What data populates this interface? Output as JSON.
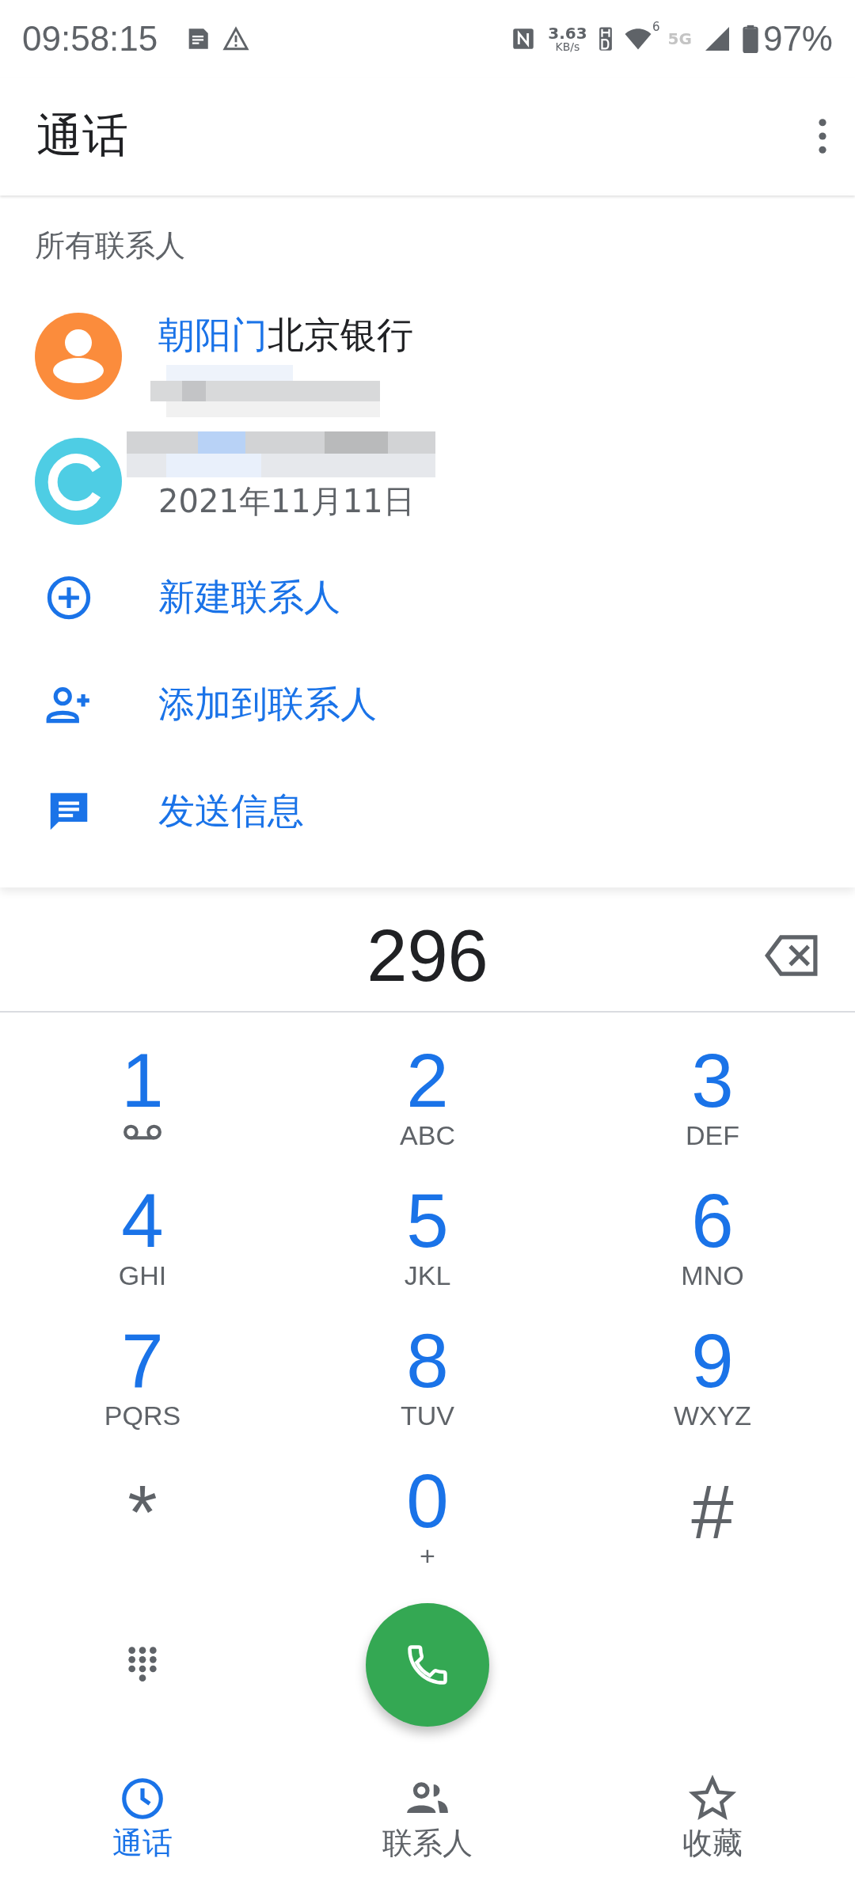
{
  "status_bar": {
    "time": "09:58:15",
    "speed_value": "3.63",
    "speed_unit": "KB/s",
    "network": "5G",
    "signal_badge": "6",
    "battery": "97%"
  },
  "app_bar": {
    "title": "通话"
  },
  "section_header": "所有联系人",
  "contacts": [
    {
      "name_match": "朝阳门",
      "name_rest": "北京银行",
      "color": "#fb8c3c",
      "kind": "person"
    },
    {
      "detail": "2021年11月11日",
      "color": "#4ecde4",
      "kind": "letter"
    }
  ],
  "actions": [
    {
      "label": "新建联系人",
      "kind": "new"
    },
    {
      "label": "添加到联系人",
      "kind": "add"
    },
    {
      "label": "发送信息",
      "kind": "message"
    }
  ],
  "dial_field": {
    "value": "296"
  },
  "keys": [
    {
      "digit": "1",
      "kind": "voicemail"
    },
    {
      "digit": "2",
      "letters": "ABC",
      "kind": "letters"
    },
    {
      "digit": "3",
      "letters": "DEF",
      "kind": "letters"
    },
    {
      "digit": "4",
      "letters": "GHI",
      "kind": "letters"
    },
    {
      "digit": "5",
      "letters": "JKL",
      "kind": "letters"
    },
    {
      "digit": "6",
      "letters": "MNO",
      "kind": "letters"
    },
    {
      "digit": "7",
      "letters": "PQRS",
      "kind": "letters"
    },
    {
      "digit": "8",
      "letters": "TUV",
      "kind": "letters"
    },
    {
      "digit": "9",
      "letters": "WXYZ",
      "kind": "letters"
    },
    {
      "digit": "*",
      "kind": "plain"
    },
    {
      "digit": "0",
      "letters": "+",
      "kind": "letters"
    },
    {
      "digit": "#",
      "kind": "plain"
    }
  ],
  "bottom_nav": [
    {
      "label": "通话",
      "kind": "recents",
      "selected": true
    },
    {
      "label": "联系人",
      "kind": "contacts",
      "selected": false
    },
    {
      "label": "收藏",
      "kind": "favorites",
      "selected": false
    }
  ]
}
